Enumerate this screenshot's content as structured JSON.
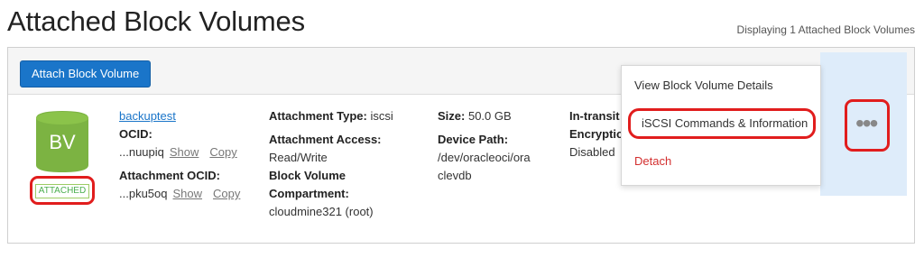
{
  "page": {
    "title": "Attached Block Volumes",
    "display_count": "Displaying 1 Attached Block Volumes"
  },
  "toolbar": {
    "attach_label": "Attach Block Volume"
  },
  "volume": {
    "icon_text": "BV",
    "state": "ATTACHED",
    "name": "backuptest",
    "ocid_label": "OCID:",
    "ocid_value": "...nuupiq",
    "attachment_ocid_label": "Attachment OCID:",
    "attachment_ocid_value": "...pku5oq",
    "show_label": "Show",
    "copy_label": "Copy",
    "attachment_type_label": "Attachment Type:",
    "attachment_type_value": "iscsi",
    "attachment_access_label": "Attachment Access:",
    "attachment_access_value": "Read/Write",
    "compartment_label_1": "Block Volume",
    "compartment_label_2": "Compartment:",
    "compartment_value": "cloudmine321 (root)",
    "size_label": "Size:",
    "size_value": "50.0 GB",
    "device_path_label": "Device Path:",
    "device_path_line1": "/dev/oracleoci/ora",
    "device_path_line2": "clevdb",
    "encryption_label_1": "In-transit",
    "encryption_label_2": "Encryption",
    "encryption_value": "Disabled"
  },
  "menu": {
    "items": [
      "View Block Volume Details",
      "iSCSI Commands & Information",
      "Detach"
    ],
    "more_label": "•••"
  },
  "colors": {
    "primary": "#1a75c9",
    "bv_green": "#7cb342",
    "attached_green": "#4caf50",
    "highlight_red": "#e11d1d",
    "detach_red": "#d32f2f",
    "menu_bg": "#deecfa"
  }
}
